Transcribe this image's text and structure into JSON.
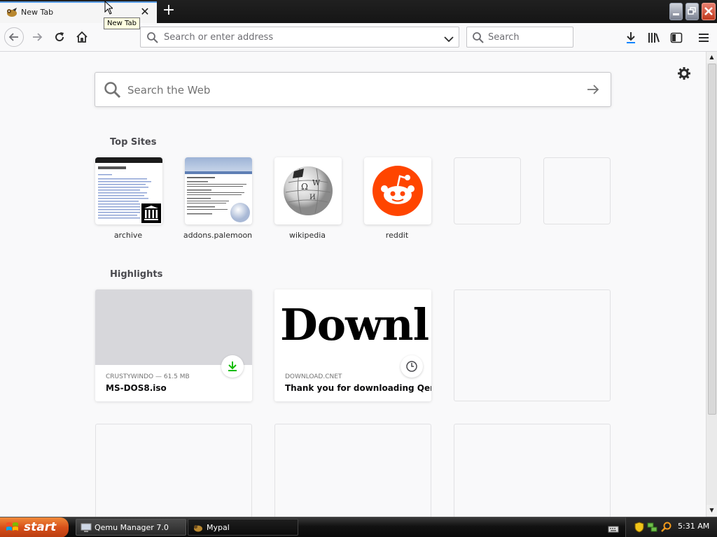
{
  "browser": {
    "tab": {
      "title": "New Tab",
      "tooltip": "New Tab"
    },
    "urlbar": {
      "placeholder": "Search or enter address"
    },
    "searchbar": {
      "placeholder": "Search"
    }
  },
  "newtab": {
    "search_placeholder": "Search the Web",
    "top_sites_title": "Top Sites",
    "top_sites": [
      {
        "label": "archive"
      },
      {
        "label": "addons.palemoon"
      },
      {
        "label": "wikipedia"
      },
      {
        "label": "reddit"
      }
    ],
    "highlights_title": "Highlights",
    "highlights": [
      {
        "context": "CRUSTYWINDO — 61.5 MB",
        "title": "MS-DOS8.iso",
        "badge_icon": "download-icon"
      },
      {
        "context": "DOWNLOAD.CNET",
        "title": "Thank you for downloading Qem...",
        "preview_text": "Downl",
        "badge_icon": "clock-icon"
      }
    ]
  },
  "taskbar": {
    "start_label": "start",
    "tasks": [
      {
        "label": "Qemu Manager 7.0"
      },
      {
        "label": "Mypal"
      }
    ],
    "clock": "5:31 AM"
  },
  "colors": {
    "accent_blue": "#5a9ee8",
    "reddit": "#ff4500",
    "download_green": "#12bc00",
    "start_orange": "#d7501a"
  }
}
